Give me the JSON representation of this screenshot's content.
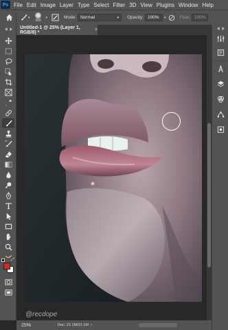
{
  "menubar": {
    "logo": "Ps",
    "items": [
      "File",
      "Edit",
      "Image",
      "Layer",
      "Type",
      "Select",
      "Filter",
      "3D",
      "View",
      "Plugins",
      "Window",
      "Help"
    ]
  },
  "options": {
    "brush_size": "300",
    "mode_label": "Mode:",
    "mode_value": "Normal",
    "opacity_label": "Opacity:",
    "opacity_value": "100%",
    "flow_label": "Flow:",
    "flow_value": "100%"
  },
  "document": {
    "tab_title": "Untitled-1 @ 25% (Layer 1, RGB/8) *",
    "close_glyph": "×"
  },
  "watermark": "@recdope",
  "status": {
    "zoom": "25%",
    "doc": "Doc: 21.1M/21.1M",
    "arrow": "›"
  },
  "colors": {
    "foreground": "#d12c1f",
    "background": "#ffffff",
    "accent": "#31a8ff",
    "ui_panel": "#535353",
    "ui_dark": "#282828"
  },
  "tools": [
    "move-icon",
    "marquee-icon",
    "lasso-icon",
    "object-select-icon",
    "crop-icon",
    "frame-icon",
    "eyedropper-icon",
    "healing-brush-icon",
    "brush-icon",
    "clone-stamp-icon",
    "history-brush-icon",
    "eraser-icon",
    "gradient-icon",
    "blur-icon",
    "dodge-icon",
    "pen-icon",
    "type-icon",
    "path-select-icon",
    "rectangle-icon",
    "hand-icon",
    "zoom-icon",
    "banana-icon",
    "quick-mask-icon",
    "screen-mode-icon"
  ],
  "right_panel": [
    "collapse-icon",
    "adjustments-icon",
    "paragraph-icon",
    "layers-icon",
    "channels-icon",
    "paths-icon",
    "properties-icon"
  ]
}
